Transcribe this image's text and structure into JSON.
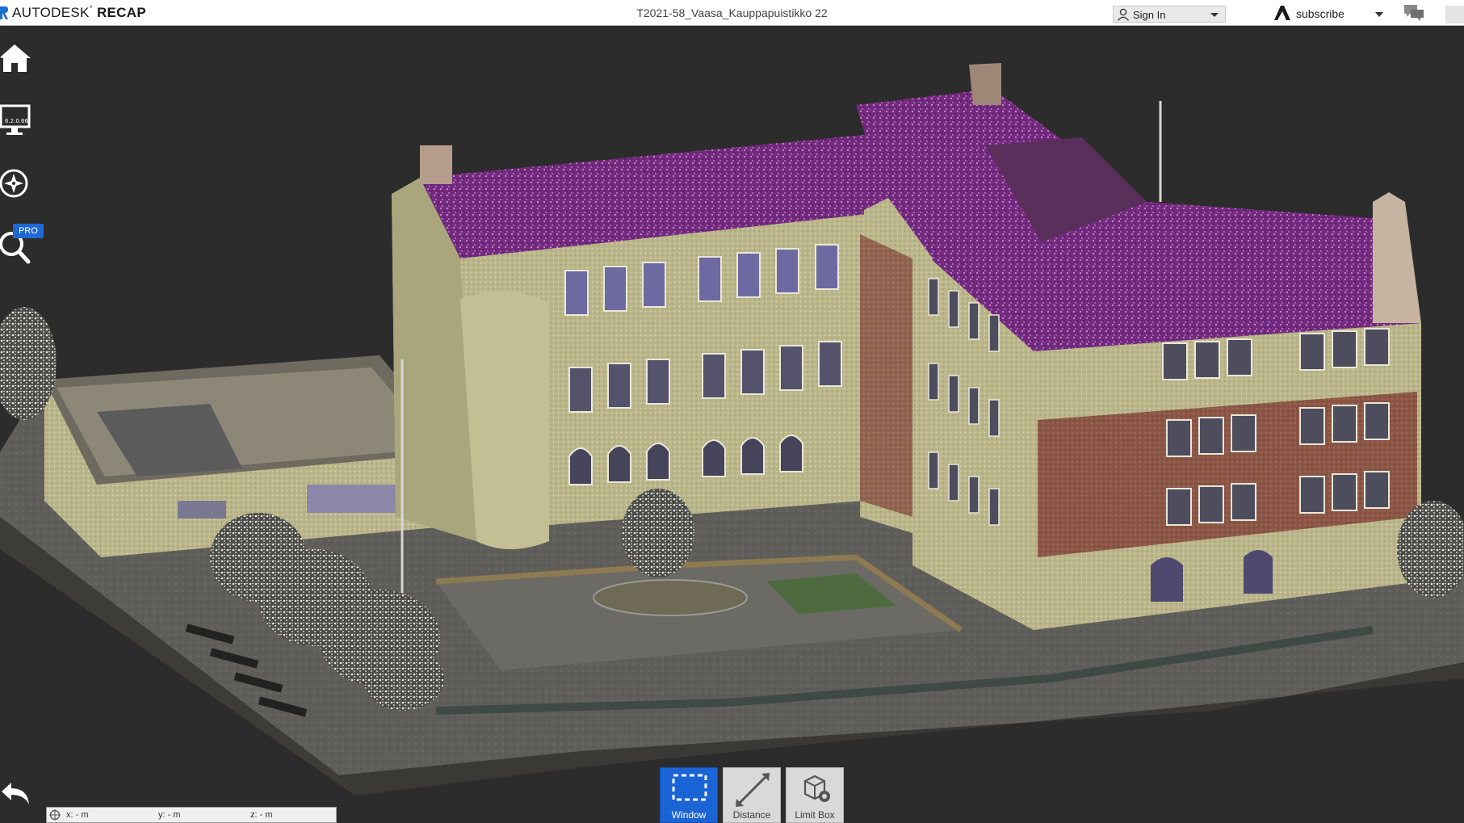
{
  "app": {
    "brand_light": "AUTODESK",
    "brand_bold": "RECAP",
    "document_title": "T2021-58_Vaasa_Kauppapuistikko 22"
  },
  "header": {
    "sign_in_label": "Sign In",
    "subscribe_label": "subscribe"
  },
  "left_toolbar": {
    "home_icon": "home-icon",
    "display_version": "6.2.0.66",
    "navigation_icon": "compass-icon",
    "search_badge": "PRO"
  },
  "coordinates": {
    "x": "x:  -  m",
    "y": "y:  -  m",
    "z": "z:  -  m"
  },
  "bottom_tools": [
    {
      "label": "Window",
      "icon": "selection-window-icon",
      "active": true
    },
    {
      "label": "Distance",
      "icon": "measure-distance-icon",
      "active": false
    },
    {
      "label": "Limit Box",
      "icon": "limit-box-icon",
      "active": false
    }
  ],
  "colors": {
    "accent": "#1b64d6",
    "viewport_bg": "#2c2c2c",
    "roof": "#7a2e86",
    "facade": "#bdb98c",
    "brick": "#8e5a4a"
  }
}
